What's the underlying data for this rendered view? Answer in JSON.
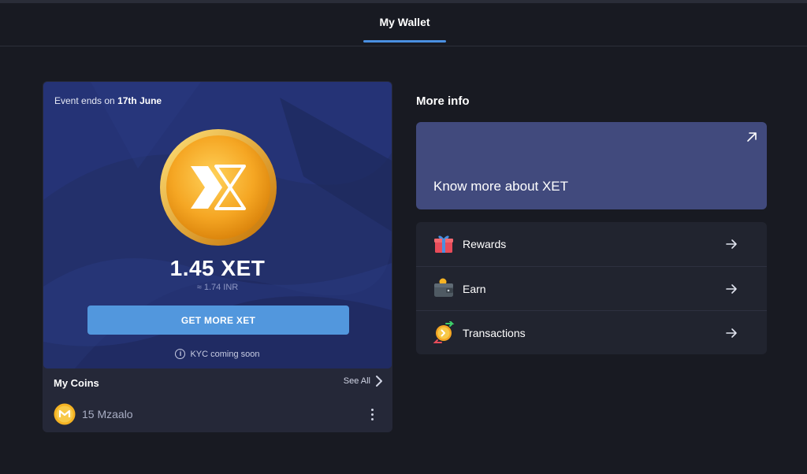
{
  "header": {
    "tab_label": "My Wallet"
  },
  "wallet": {
    "event_prefix": "Event ends on ",
    "event_date": "17th June",
    "balance": "1.45 XET",
    "inr_value": "≈ 1.74 INR",
    "cta_label": "GET MORE XET",
    "kyc_text": "KYC coming soon",
    "info_glyph": "i"
  },
  "my_coins": {
    "title": "My Coins",
    "see_all": "See All",
    "items": [
      {
        "label": "15 Mzaalo"
      }
    ]
  },
  "more_info": {
    "title": "More info",
    "know_more": "Know more about XET",
    "items": [
      {
        "label": "Rewards",
        "icon": "gift-icon"
      },
      {
        "label": "Earn",
        "icon": "wallet-icon"
      },
      {
        "label": "Transactions",
        "icon": "transactions-icon"
      }
    ]
  },
  "colors": {
    "background": "#181a22",
    "accent": "#4a90e2",
    "cta": "#5297dd",
    "hero": "#23306b",
    "know_card": "#414a7d",
    "coin_gold": "#f5a623"
  }
}
